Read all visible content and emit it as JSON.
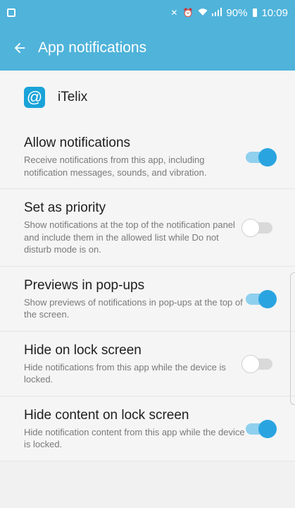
{
  "status_bar": {
    "battery": "90%",
    "time": "10:09"
  },
  "app_bar": {
    "title": "App notifications",
    "back_icon": "arrow-left-icon"
  },
  "app": {
    "name": "iTelix",
    "icon": "at-sign-icon",
    "icon_glyph": "@"
  },
  "settings": [
    {
      "title": "Allow notifications",
      "subtitle": "Receive notifications from this app, including notification messages, sounds, and vibration.",
      "enabled": true
    },
    {
      "title": "Set as priority",
      "subtitle": "Show notifications at the top of the notification panel and include them in the allowed list while Do not disturb mode is on.",
      "enabled": false
    },
    {
      "title": "Previews in pop-ups",
      "subtitle": "Show previews of notifications in pop-ups at the top of the screen.",
      "enabled": true
    },
    {
      "title": "Hide on lock screen",
      "subtitle": "Hide notifications from this app while the device is locked.",
      "enabled": false
    },
    {
      "title": "Hide content on lock screen",
      "subtitle": "Hide notification content from this app while the device is locked.",
      "enabled": true
    }
  ],
  "colors": {
    "accent": "#4fb3da",
    "switch_on_knob": "#2aa4e0",
    "switch_on_track": "#8fd0ee"
  }
}
